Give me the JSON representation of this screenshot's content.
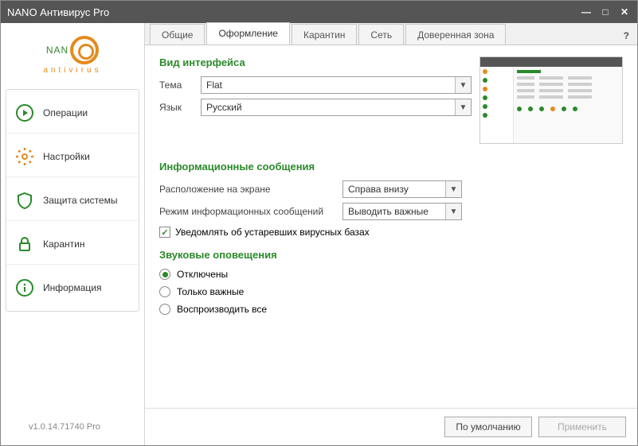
{
  "window": {
    "title": "NANO Антивирус Pro"
  },
  "logo": {
    "main": "NAN",
    "sub": "antivirus"
  },
  "sidebar": {
    "items": [
      {
        "label": "Операции"
      },
      {
        "label": "Настройки"
      },
      {
        "label": "Защита системы"
      },
      {
        "label": "Карантин"
      },
      {
        "label": "Информация"
      }
    ]
  },
  "tabs": {
    "items": [
      {
        "label": "Общие"
      },
      {
        "label": "Оформление"
      },
      {
        "label": "Карантин"
      },
      {
        "label": "Сеть"
      },
      {
        "label": "Доверенная зона"
      }
    ],
    "active_index": 1
  },
  "sections": {
    "interface": {
      "title": "Вид интерфейса",
      "theme_label": "Тема",
      "theme_value": "Flat",
      "lang_label": "Язык",
      "lang_value": "Русский"
    },
    "messages": {
      "title": "Информационные сообщения",
      "position_label": "Расположение на экране",
      "position_value": "Справа внизу",
      "mode_label": "Режим информационных сообщений",
      "mode_value": "Выводить важные",
      "notify_outdated_label": "Уведомлять об устаревших вирусных базах",
      "notify_outdated_checked": true
    },
    "sound": {
      "title": "Звуковые оповещения",
      "options": [
        {
          "label": "Отключены",
          "checked": true
        },
        {
          "label": "Только важные",
          "checked": false
        },
        {
          "label": "Воспроизводить все",
          "checked": false
        }
      ]
    }
  },
  "footer": {
    "version": "v1.0.14.71740 Pro",
    "default_btn": "По умолчанию",
    "apply_btn": "Применить"
  },
  "colors": {
    "accent": "#2a8a2a",
    "orange": "#e58a1e"
  }
}
